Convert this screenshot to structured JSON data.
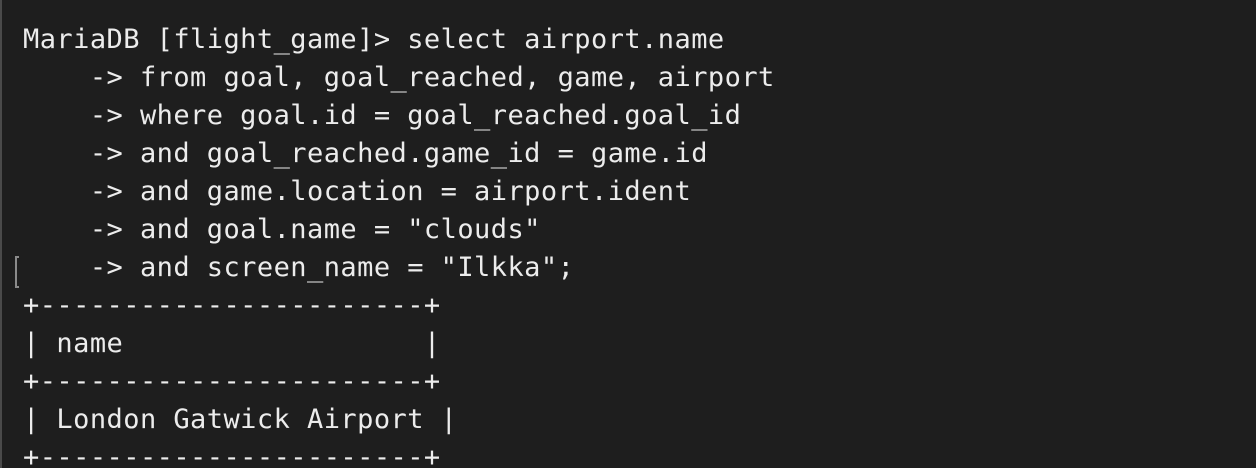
{
  "terminal": {
    "lines": [
      "MariaDB [flight_game]> select airport.name",
      "    -> from goal, goal_reached, game, airport",
      "    -> where goal.id = goal_reached.goal_id",
      "    -> and goal_reached.game_id = game.id",
      "    -> and game.location = airport.ident",
      "    -> and goal.name = \"clouds\"",
      "    -> and screen_name = \"Ilkka\";",
      "+-----------------------+",
      "| name                  |",
      "+-----------------------+",
      "| London Gatwick Airport |",
      "+-----------------------+"
    ]
  }
}
